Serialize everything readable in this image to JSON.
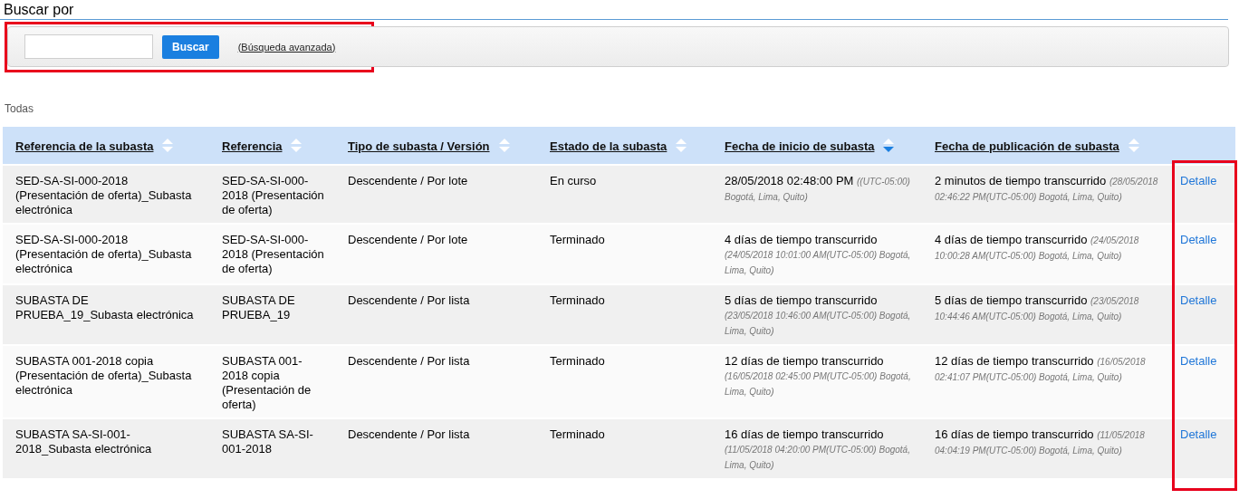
{
  "title": "Buscar por",
  "search": {
    "button": "Buscar",
    "advanced_link": "(Búsqueda avanzada)"
  },
  "filter_label": "Todas",
  "table": {
    "columns": [
      {
        "label": "Referencia de la subasta",
        "sorted": false
      },
      {
        "label": "Referencia",
        "sorted": false
      },
      {
        "label": "Tipo de subasta / Versión",
        "sorted": false
      },
      {
        "label": "Estado de la subasta",
        "sorted": false
      },
      {
        "label": "Fecha de inicio de subasta",
        "sorted": true
      },
      {
        "label": "Fecha de publicación de subasta",
        "sorted": false
      }
    ],
    "rows": [
      {
        "auction_ref": "SED-SA-SI-000-2018 (Presentación de oferta)_Subasta electrónica",
        "reference": "SED-SA-SI-000-2018 (Presentación de oferta)",
        "type": "Descendente / Por lote",
        "status": "En curso",
        "start": {
          "main": "28/05/2018 02:48:00 PM",
          "note": "((UTC-05:00) Bogotá, Lima, Quito)"
        },
        "published": {
          "main": "2 minutos de tiempo transcurrido",
          "note": "(28/05/2018 02:46:22 PM(UTC-05:00) Bogotá, Lima, Quito)"
        },
        "action": "Detalle"
      },
      {
        "auction_ref": "SED-SA-SI-000-2018 (Presentación de oferta)_Subasta electrónica",
        "reference": "SED-SA-SI-000-2018 (Presentación de oferta)",
        "type": "Descendente / Por lote",
        "status": "Terminado",
        "start": {
          "main": "4 días de tiempo transcurrido",
          "note": "(24/05/2018 10:01:00 AM(UTC-05:00) Bogotá, Lima, Quito)"
        },
        "published": {
          "main": "4 días de tiempo transcurrido",
          "note": "(24/05/2018 10:00:28 AM(UTC-05:00) Bogotá, Lima, Quito)"
        },
        "action": "Detalle"
      },
      {
        "auction_ref": "SUBASTA DE PRUEBA_19_Subasta electrónica",
        "reference": "SUBASTA DE PRUEBA_19",
        "type": "Descendente / Por lista",
        "status": "Terminado",
        "start": {
          "main": "5 días de tiempo transcurrido",
          "note": "(23/05/2018 10:46:00 AM(UTC-05:00) Bogotá, Lima, Quito)"
        },
        "published": {
          "main": "5 días de tiempo transcurrido",
          "note": "(23/05/2018 10:44:46 AM(UTC-05:00) Bogotá, Lima, Quito)"
        },
        "action": "Detalle"
      },
      {
        "auction_ref": "SUBASTA 001-2018 copia (Presentación de oferta)_Subasta electrónica",
        "reference": "SUBASTA 001-2018 copia (Presentación de oferta)",
        "type": "Descendente / Por lista",
        "status": "Terminado",
        "start": {
          "main": "12 días de tiempo transcurrido",
          "note": "(16/05/2018 02:45:00 PM(UTC-05:00) Bogotá, Lima, Quito)"
        },
        "published": {
          "main": "12 días de tiempo transcurrido",
          "note": "(16/05/2018 02:41:07 PM(UTC-05:00) Bogotá, Lima, Quito)"
        },
        "action": "Detalle"
      },
      {
        "auction_ref": "SUBASTA SA-SI-001-2018_Subasta electrónica",
        "reference": "SUBASTA SA-SI-001-2018",
        "type": "Descendente / Por lista",
        "status": "Terminado",
        "start": {
          "main": "16 días de tiempo transcurrido",
          "note": "(11/05/2018 04:20:00 PM(UTC-05:00) Bogotá, Lima, Quito)"
        },
        "published": {
          "main": "16 días de tiempo transcurrido",
          "note": "(11/05/2018 04:04:19 PM(UTC-05:00) Bogotá, Lima, Quito)"
        },
        "action": "Detalle"
      }
    ]
  }
}
